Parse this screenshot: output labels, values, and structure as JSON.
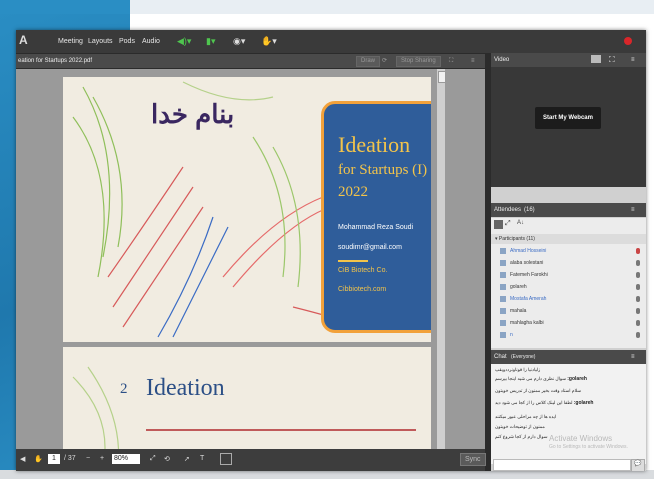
{
  "menubar": {
    "items": [
      "Meeting",
      "Layouts",
      "Pods",
      "Audio"
    ]
  },
  "share_pod": {
    "title": "eation for Startups 2022.pdf",
    "draw_label": "Draw",
    "stop_sharing_label": "Stop Sharing",
    "page_current": "1",
    "page_total": "/ 37",
    "zoom": "80%",
    "sync_label": "Sync"
  },
  "slide1": {
    "persian_title": "بنام خدا",
    "title_line1": "Ideation",
    "title_line2": "for Startups (I)",
    "title_line3": "2022",
    "author": "Mohammad Reza Soudi",
    "email": "soudimr@gmail.com",
    "company": "CiB Biotech Co.",
    "website": "Cibbiotech.com"
  },
  "slide2": {
    "number": "2",
    "title": "Ideation"
  },
  "video_pod": {
    "title": "Video",
    "webcam_button": "Start My Webcam"
  },
  "attendees_pod": {
    "title": "Attendees",
    "count": "(16)",
    "group_label": "Participants (11)",
    "participants": [
      "Ahmad Hosseini",
      "alaba solestani",
      "Fatemeh Farokhi",
      "golareh",
      "Mostafa Amerah",
      "mahala",
      "mahlagha kalbi",
      "n"
    ]
  },
  "chat_pod": {
    "title": "Chat",
    "subtitle": "(Everyone)",
    "messages": [
      {
        "author": "",
        "text": "زلیادنیا را قوناونرددویقپ"
      },
      {
        "author": "golareh:",
        "text": "سوال نظری دارم می شیه اینجا بپرسم"
      },
      {
        "author": "",
        "text": "سلام استاد وقت بخیر ممنون از تدریس خوبتون"
      },
      {
        "author": "golareh:",
        "text": "لطفا این لینک کلاس را از کجا می شود دید"
      },
      {
        "author": "",
        "text": "ایده ها از چه مراحلی عبور میکنند"
      },
      {
        "author": "",
        "text": "ممنون از توضیحات خوبتون"
      },
      {
        "author": "",
        "text": "سوال دارم از کجا شروع کنم"
      }
    ],
    "watermark_title": "Activate Windows",
    "watermark_sub": "Go to Settings to activate Windows."
  },
  "colors": {
    "slide_bg": "#f1ece1",
    "card_blue": "#2f5d9a",
    "card_border": "#f2a13a",
    "title_gold": "#f3c44a",
    "ideation_blue": "#2c4f86"
  }
}
